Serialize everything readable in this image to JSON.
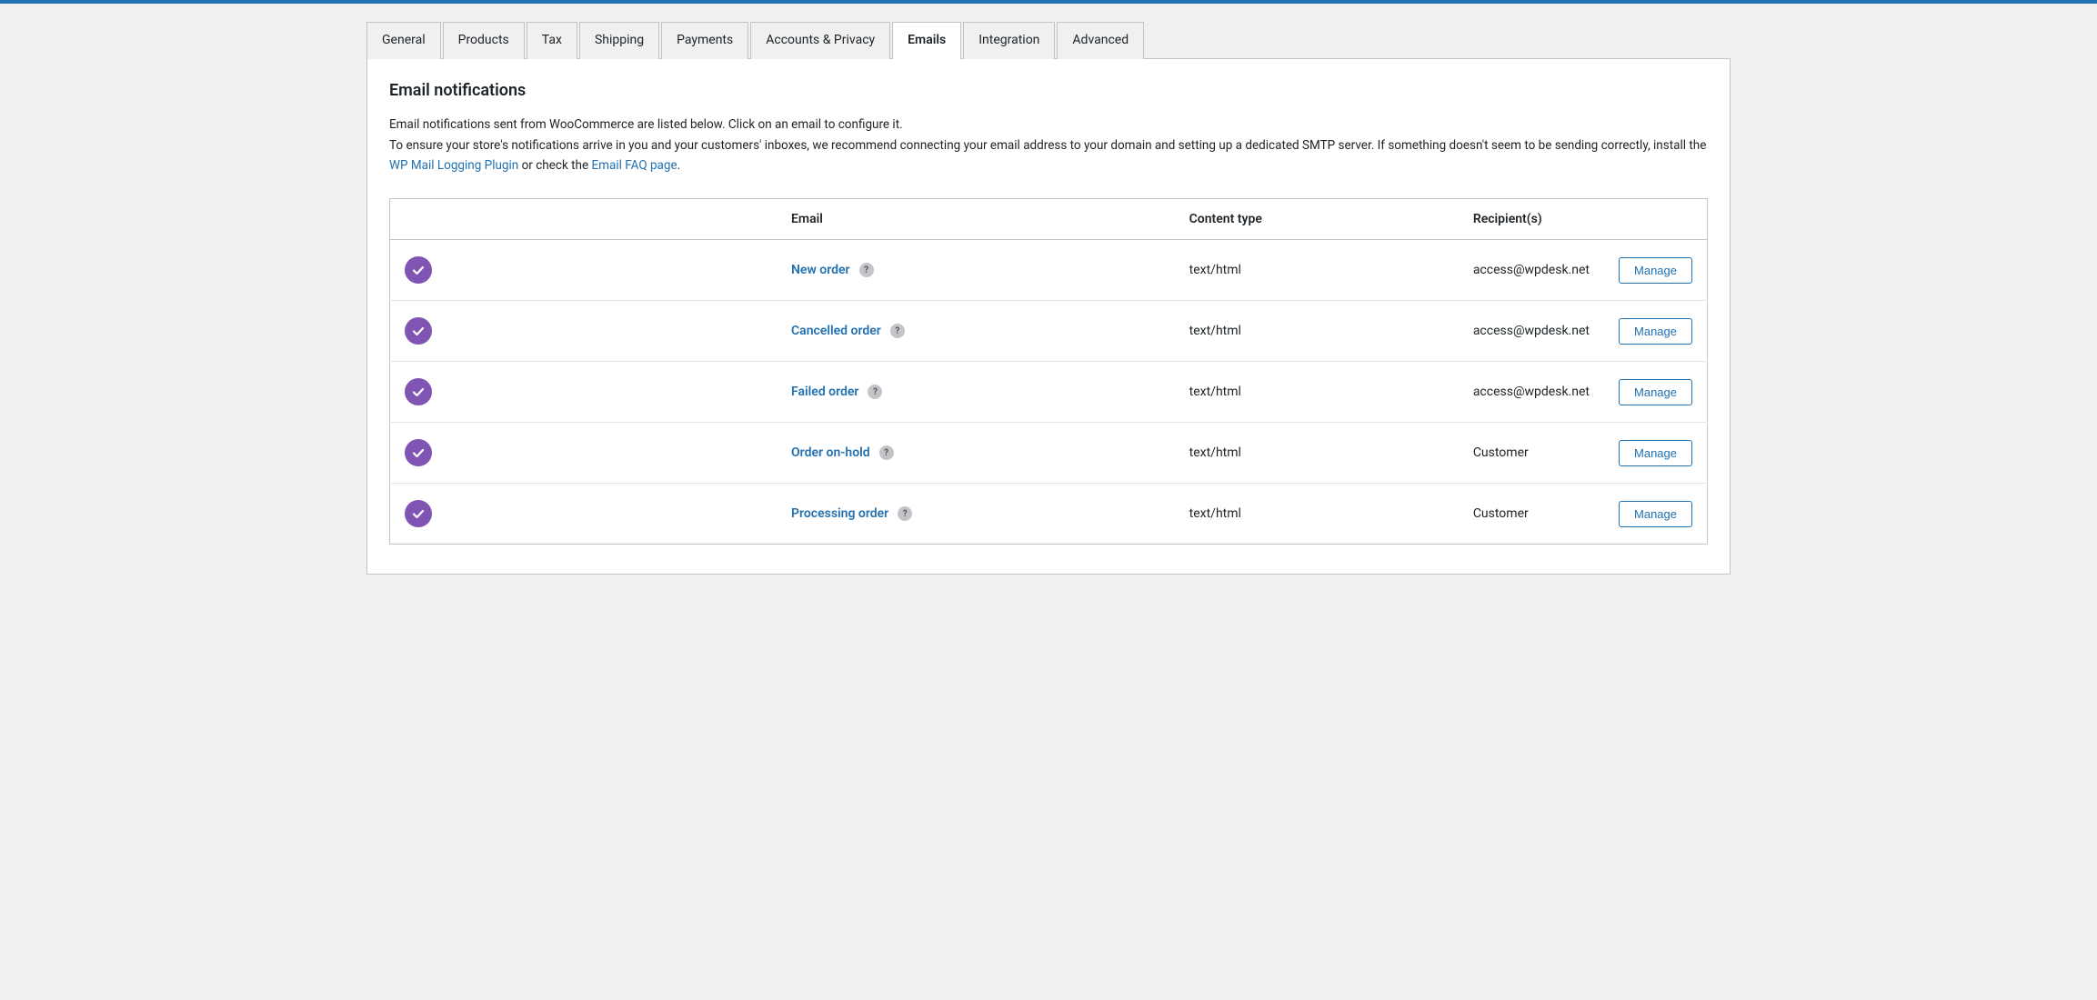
{
  "topbar": {},
  "tabs": [
    {
      "id": "general",
      "label": "General",
      "active": false
    },
    {
      "id": "products",
      "label": "Products",
      "active": false
    },
    {
      "id": "tax",
      "label": "Tax",
      "active": false
    },
    {
      "id": "shipping",
      "label": "Shipping",
      "active": false
    },
    {
      "id": "payments",
      "label": "Payments",
      "active": false
    },
    {
      "id": "accounts-privacy",
      "label": "Accounts & Privacy",
      "active": false
    },
    {
      "id": "emails",
      "label": "Emails",
      "active": true
    },
    {
      "id": "integration",
      "label": "Integration",
      "active": false
    },
    {
      "id": "advanced",
      "label": "Advanced",
      "active": false
    }
  ],
  "section": {
    "title": "Email notifications",
    "description_part1": "Email notifications sent from WooCommerce are listed below. Click on an email to configure it.",
    "description_part2": "To ensure your store's notifications arrive in you and your customers' inboxes, we recommend connecting your email address to your domain and setting up a dedicated SMTP server. If something doesn't seem to be sending correctly, install the ",
    "link1_text": "WP Mail Logging Plugin",
    "description_part3": " or check the ",
    "link2_text": "Email FAQ page",
    "description_part4": "."
  },
  "table": {
    "columns": [
      {
        "id": "email",
        "label": "Email"
      },
      {
        "id": "content_type",
        "label": "Content type"
      },
      {
        "id": "recipients",
        "label": "Recipient(s)"
      },
      {
        "id": "action",
        "label": ""
      }
    ],
    "rows": [
      {
        "id": "new-order",
        "enabled": true,
        "name": "New order",
        "content_type": "text/html",
        "recipient": "access@wpdesk.net",
        "manage_label": "Manage"
      },
      {
        "id": "cancelled-order",
        "enabled": true,
        "name": "Cancelled order",
        "content_type": "text/html",
        "recipient": "access@wpdesk.net",
        "manage_label": "Manage"
      },
      {
        "id": "failed-order",
        "enabled": true,
        "name": "Failed order",
        "content_type": "text/html",
        "recipient": "access@wpdesk.net",
        "manage_label": "Manage"
      },
      {
        "id": "order-on-hold",
        "enabled": true,
        "name": "Order on-hold",
        "content_type": "text/html",
        "recipient": "Customer",
        "manage_label": "Manage"
      },
      {
        "id": "processing-order",
        "enabled": true,
        "name": "Processing order",
        "content_type": "text/html",
        "recipient": "Customer",
        "manage_label": "Manage"
      }
    ]
  }
}
